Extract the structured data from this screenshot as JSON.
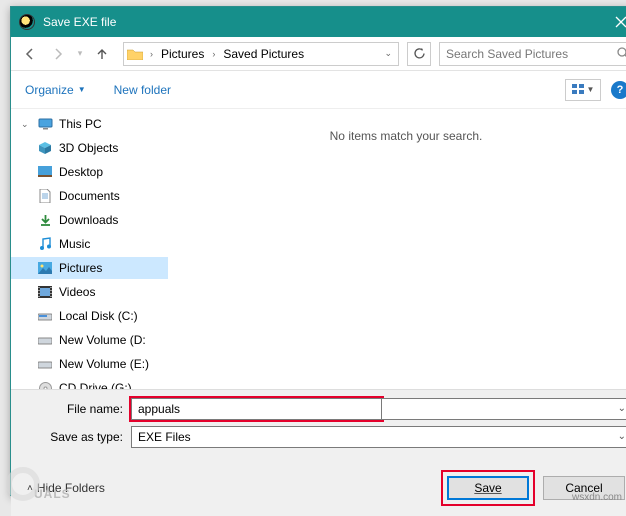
{
  "titlebar": {
    "title": "Save EXE file"
  },
  "nav": {
    "breadcrumb": [
      "Pictures",
      "Saved Pictures"
    ],
    "search_placeholder": "Search Saved Pictures"
  },
  "toolbar": {
    "organize": "Organize",
    "newfolder": "New folder"
  },
  "tree": {
    "root": "This PC",
    "items": [
      {
        "label": "3D Objects"
      },
      {
        "label": "Desktop"
      },
      {
        "label": "Documents"
      },
      {
        "label": "Downloads"
      },
      {
        "label": "Music"
      },
      {
        "label": "Pictures",
        "selected": true
      },
      {
        "label": "Videos"
      },
      {
        "label": "Local Disk (C:)"
      },
      {
        "label": "New Volume (D:"
      },
      {
        "label": "New Volume (E:)"
      },
      {
        "label": "CD Drive (G:)"
      }
    ]
  },
  "main": {
    "empty": "No items match your search."
  },
  "bottom": {
    "filename_label": "File name:",
    "filename_value": "appuals",
    "type_label": "Save as type:",
    "type_value": "EXE Files",
    "hide_folders": "Hide Folders",
    "save": "Save",
    "cancel": "Cancel"
  },
  "watermark": {
    "text": "UALS",
    "src": "wsxdn.com"
  }
}
